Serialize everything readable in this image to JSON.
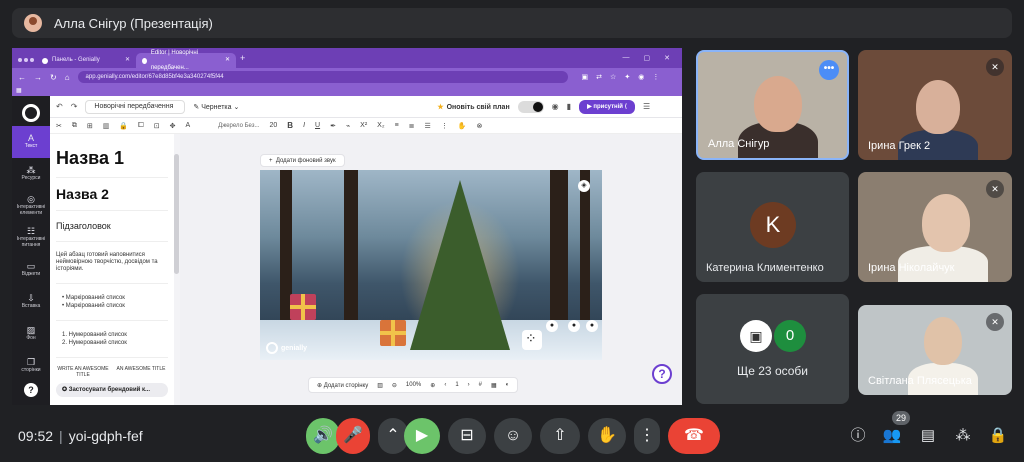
{
  "presenter_bar": {
    "title": "Алла Снігур (Презентація)"
  },
  "browser": {
    "tabs": [
      {
        "label": "Панель - Genially",
        "active": false
      },
      {
        "label": "Editor | Новорічні передбачен...",
        "active": true
      }
    ],
    "url": "app.genially.com/editor/67e8d85bf4e3a340274f5f44"
  },
  "editor": {
    "doc_title": "Новорічні передбачення",
    "status": "Чернетка",
    "upgrade_label": "Оновіть свій план",
    "present_label": "присутній",
    "font_name": "Джерело Без...",
    "font_size": "20",
    "rail": [
      {
        "icon": "A",
        "label": "Текст",
        "active": true
      },
      {
        "icon": "⁂",
        "label": "Ресурси",
        "active": false
      },
      {
        "icon": "◎",
        "label": "Інтерактивні елементи",
        "active": false
      },
      {
        "icon": "☷",
        "label": "Інтерактивні питання",
        "active": false
      },
      {
        "icon": "▭",
        "label": "Віджети",
        "active": false
      },
      {
        "icon": "⇩",
        "label": "Вставка",
        "active": false
      },
      {
        "icon": "▨",
        "label": "Фон",
        "active": false
      },
      {
        "icon": "❐",
        "label": "сторінки",
        "active": false
      }
    ],
    "text_panel": {
      "h1": "Назва 1",
      "h2": "Назва 2",
      "subtitle": "Підзаголовок",
      "paragraph": "Цей абзац готовий наповнитися неймовірною творчістю, досвідом та історіями.",
      "bullets": [
        "Маркірований список",
        "Маркірований список"
      ],
      "numbered": [
        "1. Нумерований список",
        "2. Нумерований список"
      ],
      "sample_left": "WRITE AN AWESOME TITLE",
      "sample_right": "AN AWESOME TITLE",
      "brand_button": "Застосувати брендовий к..."
    },
    "canvas": {
      "add_sound": "Додати фоновий звук",
      "slide_brand": "genially",
      "add_page": "Додати сторінку",
      "zoom": "100%",
      "page": "1"
    }
  },
  "participants": [
    {
      "name": "Алла Снігур",
      "muted": false
    },
    {
      "name": "Ірина Грек 2",
      "muted": true
    },
    {
      "name": "Катерина Климентенко",
      "initial": "K",
      "avatar_color": "#6d3b22"
    },
    {
      "name": "Ірина Ніколайчук",
      "muted": true
    },
    {
      "name": "Ще 23 особи",
      "extra_badge": "0"
    },
    {
      "name": "Світлана Плясецька",
      "muted": true
    }
  ],
  "meeting": {
    "time": "09:52",
    "code": "yoi-gdph-fef",
    "people_count": "29"
  }
}
